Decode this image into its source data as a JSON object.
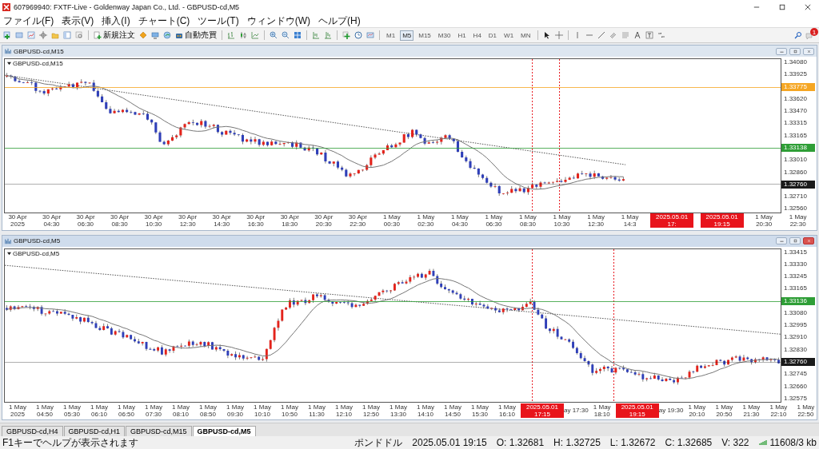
{
  "window": {
    "title": "607969940: FXTF-Live - Goldenway Japan Co., Ltd. - GBPUSD-cd,M5"
  },
  "menu": [
    "ファイル(F)",
    "表示(V)",
    "挿入(I)",
    "チャート(C)",
    "ツール(T)",
    "ウィンドウ(W)",
    "ヘルプ(H)"
  ],
  "toolbar": {
    "new_order": "新規注文",
    "auto_trading": "自動売買",
    "notification_count": "1",
    "timeframes": [
      {
        "label": "M1",
        "selected": false
      },
      {
        "label": "M5",
        "selected": true
      },
      {
        "label": "M15",
        "selected": false
      },
      {
        "label": "M30",
        "selected": false
      },
      {
        "label": "H1",
        "selected": false
      },
      {
        "label": "H4",
        "selected": false
      },
      {
        "label": "D1",
        "selected": false
      },
      {
        "label": "W1",
        "selected": false
      },
      {
        "label": "MN",
        "selected": false
      }
    ]
  },
  "charts": [
    {
      "title": "GBPUSD-cd,M15",
      "label": "GBPUSD-cd,M15",
      "active": false,
      "price_axis": [
        {
          "kind": "tick",
          "text": "1.34080"
        },
        {
          "kind": "tick",
          "text": "1.33925"
        },
        {
          "kind": "line",
          "text": "1.33775",
          "color": "#f5a623"
        },
        {
          "kind": "tick",
          "text": "1.33620"
        },
        {
          "kind": "tick",
          "text": "1.33470"
        },
        {
          "kind": "tick",
          "text": "1.33315"
        },
        {
          "kind": "tick",
          "text": "1.33165"
        },
        {
          "kind": "line",
          "text": "1.33138",
          "color": "#2e9e36"
        },
        {
          "kind": "tick",
          "text": "1.33010"
        },
        {
          "kind": "tick",
          "text": "1.32860"
        },
        {
          "kind": "line",
          "text": "1.32760",
          "color": "#1a1a1a"
        },
        {
          "kind": "tick",
          "text": "1.32710"
        },
        {
          "kind": "tick",
          "text": "1.32560"
        }
      ],
      "time_axis": [
        {
          "kind": "tick",
          "text": "30 Apr 2025"
        },
        {
          "kind": "tick",
          "text": "30 Apr 04:30"
        },
        {
          "kind": "tick",
          "text": "30 Apr 06:30"
        },
        {
          "kind": "tick",
          "text": "30 Apr 08:30"
        },
        {
          "kind": "tick",
          "text": "30 Apr 10:30"
        },
        {
          "kind": "tick",
          "text": "30 Apr 12:30"
        },
        {
          "kind": "tick",
          "text": "30 Apr 14:30"
        },
        {
          "kind": "tick",
          "text": "30 Apr 16:30"
        },
        {
          "kind": "tick",
          "text": "30 Apr 18:30"
        },
        {
          "kind": "tick",
          "text": "30 Apr 20:30"
        },
        {
          "kind": "tick",
          "text": "30 Apr 22:30"
        },
        {
          "kind": "tick",
          "text": "1 May 00:30"
        },
        {
          "kind": "tick",
          "text": "1 May 02:30"
        },
        {
          "kind": "tick",
          "text": "1 May 04:30"
        },
        {
          "kind": "tick",
          "text": "1 May 06:30"
        },
        {
          "kind": "tick",
          "text": "1 May 08:30"
        },
        {
          "kind": "tick",
          "text": "1 May 10:30"
        },
        {
          "kind": "tick",
          "text": "1 May 12:30"
        },
        {
          "kind": "tick",
          "text": "1 May 14:3"
        },
        {
          "kind": "marker",
          "text": "2025.05.01 17:"
        },
        {
          "kind": "marker",
          "text": "2025.05.01 19:15"
        },
        {
          "kind": "tick",
          "text": "1 May 20:30"
        },
        {
          "kind": "tick",
          "text": "1 May 22:30"
        }
      ]
    },
    {
      "title": "GBPUSD-cd,M5",
      "label": "GBPUSD-cd,M5",
      "active": true,
      "price_axis": [
        {
          "kind": "tick",
          "text": "1.33415"
        },
        {
          "kind": "tick",
          "text": "1.33330"
        },
        {
          "kind": "tick",
          "text": "1.33245"
        },
        {
          "kind": "tick",
          "text": "1.33165"
        },
        {
          "kind": "line",
          "text": "1.33136",
          "color": "#2e9e36"
        },
        {
          "kind": "tick",
          "text": "1.33080"
        },
        {
          "kind": "tick",
          "text": "1.32995"
        },
        {
          "kind": "tick",
          "text": "1.32910"
        },
        {
          "kind": "tick",
          "text": "1.32830"
        },
        {
          "kind": "line",
          "text": "1.32760",
          "color": "#1a1a1a"
        },
        {
          "kind": "tick",
          "text": "1.32745"
        },
        {
          "kind": "tick",
          "text": "1.32660"
        },
        {
          "kind": "tick",
          "text": "1.32575"
        }
      ],
      "time_axis": [
        {
          "kind": "tick",
          "text": "1 May 2025"
        },
        {
          "kind": "tick",
          "text": "1 May 04:50"
        },
        {
          "kind": "tick",
          "text": "1 May 05:30"
        },
        {
          "kind": "tick",
          "text": "1 May 06:10"
        },
        {
          "kind": "tick",
          "text": "1 May 06:50"
        },
        {
          "kind": "tick",
          "text": "1 May 07:30"
        },
        {
          "kind": "tick",
          "text": "1 May 08:10"
        },
        {
          "kind": "tick",
          "text": "1 May 08:50"
        },
        {
          "kind": "tick",
          "text": "1 May 09:30"
        },
        {
          "kind": "tick",
          "text": "1 May 10:10"
        },
        {
          "kind": "tick",
          "text": "1 May 10:50"
        },
        {
          "kind": "tick",
          "text": "1 May 11:30"
        },
        {
          "kind": "tick",
          "text": "1 May 12:10"
        },
        {
          "kind": "tick",
          "text": "1 May 12:50"
        },
        {
          "kind": "tick",
          "text": "1 May 13:30"
        },
        {
          "kind": "tick",
          "text": "1 May 14:10"
        },
        {
          "kind": "tick",
          "text": "1 May 14:50"
        },
        {
          "kind": "tick",
          "text": "1 May 15:30"
        },
        {
          "kind": "tick",
          "text": "1 May 16:10"
        },
        {
          "kind": "marker",
          "text": "2025.05.01 17:15"
        },
        {
          "kind": "tick",
          "text": "ay 17:30"
        },
        {
          "kind": "tick",
          "text": "1 May 18:10"
        },
        {
          "kind": "marker",
          "text": "2025.05.01 19:15"
        },
        {
          "kind": "tick",
          "text": "ay 19:30"
        },
        {
          "kind": "tick",
          "text": "1 May 20:10"
        },
        {
          "kind": "tick",
          "text": "1 May 20:50"
        },
        {
          "kind": "tick",
          "text": "1 May 21:30"
        },
        {
          "kind": "tick",
          "text": "1 May 22:10"
        },
        {
          "kind": "tick",
          "text": "1 May 22:50"
        }
      ]
    }
  ],
  "tabs": [
    {
      "label": "GBPUSD-cd,H4",
      "selected": false
    },
    {
      "label": "GBPUSD-cd,H1",
      "selected": false
    },
    {
      "label": "GBPUSD-cd,M15",
      "selected": false
    },
    {
      "label": "GBPUSD-cd,M5",
      "selected": true
    }
  ],
  "status_bar": {
    "help": "F1キーでヘルプが表示されます",
    "symbol": "ポンドドル",
    "fields": [
      "2025.05.01 19:15",
      "O: 1.32681",
      "H: 1.32725",
      "L: 1.32672",
      "C: 1.32685",
      "V: 322"
    ],
    "traffic": "11608/3 kb"
  }
}
